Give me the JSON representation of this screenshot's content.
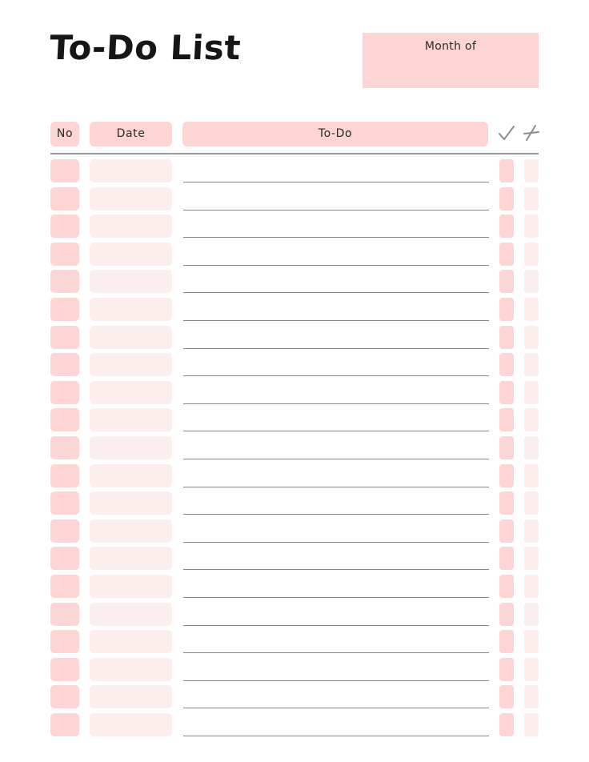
{
  "page": {
    "title": "To-Do List",
    "month_label": "Month of"
  },
  "table": {
    "headers": {
      "no": "No",
      "date": "Date",
      "todo": "To-Do",
      "done_icon": "check-icon",
      "not_done_icon": "cross-icon"
    },
    "row_count": 21
  },
  "colors": {
    "accent_pink": "#fdd5d5",
    "light_pink": "#fdeeee",
    "rule_gray": "#8a8a8a",
    "text": "#161616"
  }
}
